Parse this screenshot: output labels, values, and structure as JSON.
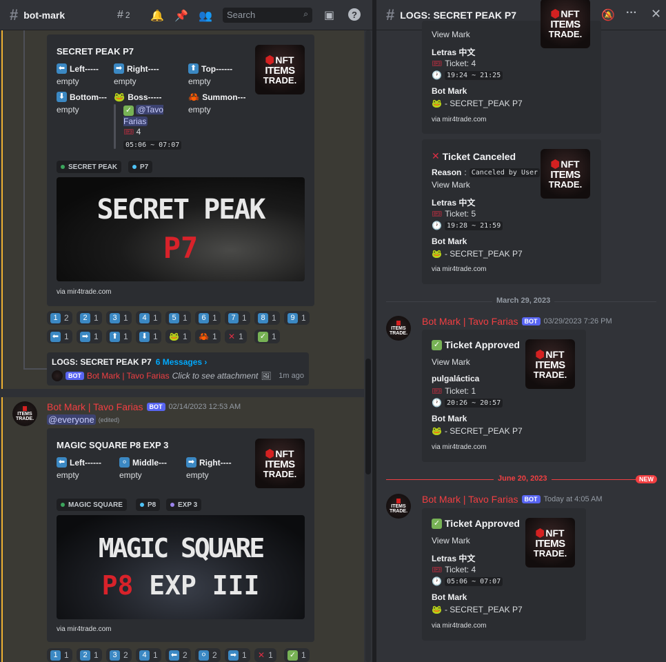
{
  "left_header": {
    "channel": "bot-mark",
    "threads_count": "2",
    "search_placeholder": "Search"
  },
  "right_header": {
    "title": "LOGS: SECRET PEAK P7"
  },
  "embed1": {
    "title": "SECRET PEAK  P7",
    "fields": [
      {
        "icon": "⬅",
        "name": "Left-----",
        "value": "empty"
      },
      {
        "icon": "➡",
        "name": "Right----",
        "value": "empty"
      },
      {
        "icon": "⬆",
        "name": "Top------",
        "value": "empty"
      },
      {
        "icon": "⬇",
        "name": "Bottom---",
        "value": "empty"
      },
      {
        "icon": "🐸",
        "name": "Boss-----",
        "mention": "@Tavo Farias",
        "tickets": "4",
        "time": "05:06 ~ 07:07"
      },
      {
        "icon": "🦀",
        "name": "Summon---",
        "value": "empty"
      }
    ],
    "tags": [
      {
        "label": "SECRET PEAK",
        "color": "#3ba55c"
      },
      {
        "label": "P7",
        "color": "#4fc3f7"
      }
    ],
    "image_title": "SECRET PEAK",
    "image_sub": "P7",
    "via": "via mir4trade.com"
  },
  "reactions1": [
    {
      "e": "1",
      "c": "2"
    },
    {
      "e": "2",
      "c": "1"
    },
    {
      "e": "3",
      "c": "1"
    },
    {
      "e": "4",
      "c": "1"
    },
    {
      "e": "5",
      "c": "1"
    },
    {
      "e": "6",
      "c": "1"
    },
    {
      "e": "7",
      "c": "1"
    },
    {
      "e": "8",
      "c": "1"
    },
    {
      "e": "9",
      "c": "1"
    }
  ],
  "reactions2": [
    {
      "e": "⬅",
      "c": "1"
    },
    {
      "e": "➡",
      "c": "1"
    },
    {
      "e": "⬆",
      "c": "1"
    },
    {
      "e": "⬇",
      "c": "1"
    },
    {
      "e": "🐸",
      "c": "1"
    },
    {
      "e": "🦀",
      "c": "1"
    },
    {
      "e": "❌",
      "c": "1"
    },
    {
      "e": "✅",
      "c": "1"
    }
  ],
  "thread": {
    "title": "LOGS: SECRET PEAK P7",
    "messages": "6 Messages ›",
    "bot": "BOT",
    "author": "Bot Mark | Tavo Farias",
    "text": "Click to see attachment",
    "time": "1m ago"
  },
  "msg2": {
    "author": "Bot Mark | Tavo Farias",
    "bot": "BOT",
    "time": "02/14/2023 12:53 AM",
    "mention": "@everyone",
    "edited": "(edited)"
  },
  "embed2": {
    "title": "MAGIC SQUARE  P8 EXP 3",
    "fields": [
      {
        "icon": "⬅",
        "name": "Left------",
        "value": "empty"
      },
      {
        "icon": "⚪",
        "name": "Middle---",
        "value": "empty"
      },
      {
        "icon": "➡",
        "name": "Right----",
        "value": "empty"
      }
    ],
    "tags": [
      {
        "label": "MAGIC SQUARE",
        "color": "#3ba55c"
      },
      {
        "label": "P8",
        "color": "#4fc3f7"
      },
      {
        "label": "EXP 3",
        "color": "#9b84ec"
      }
    ],
    "image_title": "MAGIC SQUARE",
    "image_sub1": "P8",
    "image_sub2": "EXP III",
    "via": "via mir4trade.com"
  },
  "reactions3": [
    {
      "e": "1",
      "c": "1"
    },
    {
      "e": "2",
      "c": "1"
    },
    {
      "e": "3",
      "c": "2"
    },
    {
      "e": "4",
      "c": "1"
    },
    {
      "e": "⬅",
      "c": "2"
    },
    {
      "e": "⚪",
      "c": "2"
    },
    {
      "e": "➡",
      "c": "1"
    },
    {
      "e": "❌",
      "c": "1"
    },
    {
      "e": "✅",
      "c": "1"
    }
  ],
  "logo": {
    "nft": "NFT",
    "items": "ITEMS",
    "trade": "TRADE."
  },
  "log1": {
    "view": "View Mark",
    "user": "Letras 中文",
    "ticket": "Ticket: 4",
    "time": "19:24 ~ 21:25",
    "bot_name": "Bot Mark",
    "boss": "- SECRET_PEAK P7",
    "via": "via mir4trade.com"
  },
  "log2": {
    "title": "Ticket Canceled",
    "reason_label": "Reason",
    "reason": "Canceled by User",
    "view": "View Mark",
    "user": "Letras 中文",
    "ticket": "Ticket: 5",
    "time": "19:28 ~ 21:59",
    "bot_name": "Bot Mark",
    "boss": "- SECRET_PEAK P7",
    "via": "via mir4trade.com"
  },
  "date1": "March 29, 2023",
  "log3": {
    "author": "Bot Mark | Tavo Farias",
    "bot": "BOT",
    "ts": "03/29/2023 7:26 PM",
    "title": "Ticket Approved",
    "view": "View Mark",
    "user": "pulgaláctica",
    "ticket": "Ticket: 1",
    "time": "20:26 ~ 20:57",
    "bot_name": "Bot Mark",
    "boss": "- SECRET_PEAK P7",
    "via": "via mir4trade.com"
  },
  "date2": "June 20, 2023",
  "new": "NEW",
  "log4": {
    "author": "Bot Mark | Tavo Farias",
    "bot": "BOT",
    "ts": "Today at 4:05 AM",
    "title": "Ticket Approved",
    "view": "View Mark",
    "user": "Letras 中文",
    "ticket": "Ticket: 4",
    "time": "05:06 ~ 07:07",
    "bot_name": "Bot Mark",
    "boss": "- SECRET_PEAK P7",
    "via": "via mir4trade.com"
  }
}
